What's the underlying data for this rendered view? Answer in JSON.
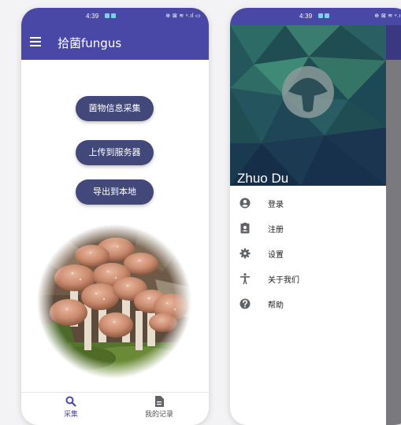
{
  "status_bar": {
    "time": "4:39",
    "system_icons": "⊕ ⊠ ≋ ⁿ.ıl ▭"
  },
  "app_bar": {
    "title": "拾菌fungus"
  },
  "actions": {
    "collect": "菌物信息采集",
    "upload": "上传到服务器",
    "export": "导出到本地"
  },
  "bottom_nav": [
    {
      "label": "采集",
      "icon": "search-icon",
      "active": true
    },
    {
      "label": "我的记录",
      "icon": "document-icon",
      "active": false
    }
  ],
  "drawer": {
    "user_name": "Zhuo Du",
    "items": [
      {
        "label": "登录",
        "icon": "account-circle-icon"
      },
      {
        "label": "注册",
        "icon": "contact-badge-icon"
      },
      {
        "label": "设置",
        "icon": "gear-icon"
      },
      {
        "label": "关于我们",
        "icon": "accessibility-person-icon"
      },
      {
        "label": "帮助",
        "icon": "help-circle-icon"
      }
    ]
  },
  "colors": {
    "primary": "#4a48a6",
    "button": "#42487a",
    "icon_gray": "#5f6368"
  }
}
